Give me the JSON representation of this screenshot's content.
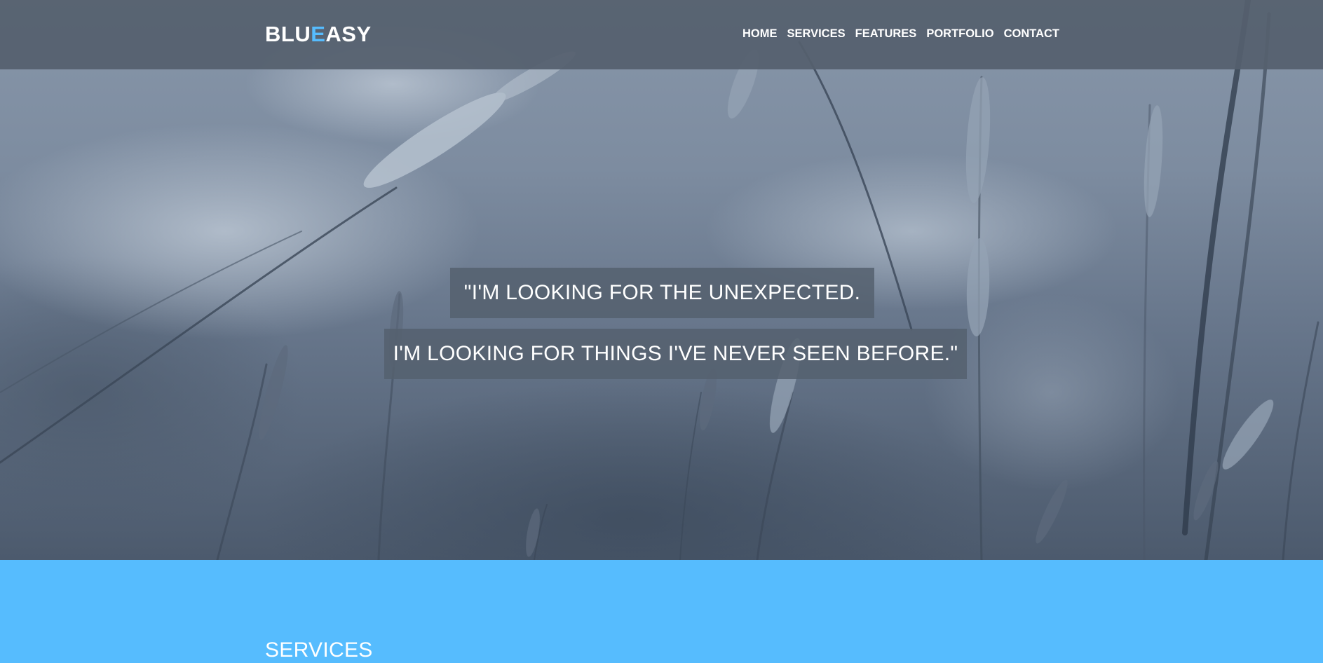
{
  "brand": {
    "part1": "BLU",
    "accent": "E",
    "part2": "ASY",
    "accent_color": "#56bcfe"
  },
  "nav": {
    "items": [
      {
        "label": "HOME"
      },
      {
        "label": "SERVICES"
      },
      {
        "label": "FEATURES"
      },
      {
        "label": "PORTFOLIO"
      },
      {
        "label": "CONTACT"
      }
    ]
  },
  "hero": {
    "quote_line1": "\"I'M LOOKING FOR THE UNEXPECTED.",
    "quote_line2": "I'M LOOKING FOR THINGS I'VE NEVER SEEN BEFORE.\""
  },
  "services": {
    "heading": "SERVICES",
    "background_color": "#56bcfe"
  },
  "colors": {
    "navbar_bg": "#55606e",
    "text": "#ffffff"
  }
}
